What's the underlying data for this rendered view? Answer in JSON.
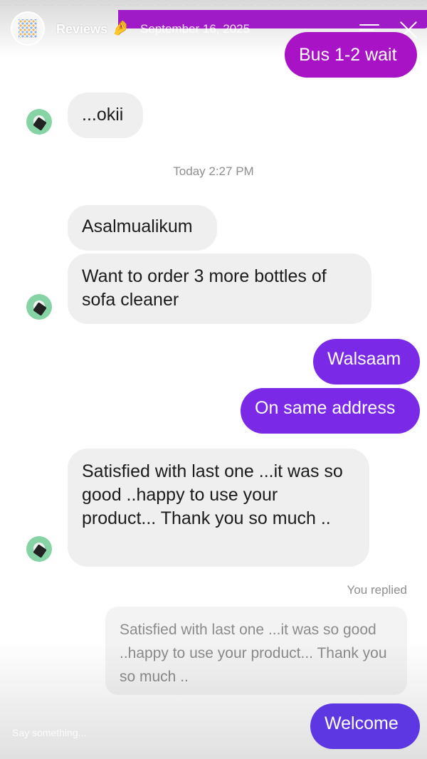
{
  "story": {
    "account_name": "Reviews",
    "emoji": "🤌",
    "date": "September 16, 2025"
  },
  "messages": {
    "bus_wait": "Bus 1-2 wait",
    "okii": "...okii",
    "timestamp": "Today 2:27 PM",
    "salam": "Asalmualikum",
    "order": "Want to order 3 more bottles of sofa cleaner",
    "walsaam": "Walsaam",
    "same_address": "On same address",
    "satisfied": "Satisfied with last one ...it was so good ..happy to use your product... Thank you so much ..",
    "welcome": "Welcome"
  },
  "reply": {
    "label": "You replied",
    "quoted_text": "Satisfied with last one ...it was so good ..happy to use your product... Thank you so much .."
  },
  "input": {
    "placeholder": "Say something..."
  },
  "colors": {
    "magenta": "#a913c6",
    "purple": "#7a29e6",
    "blue_purple": "#5d37e2",
    "incoming": "#efefef"
  }
}
